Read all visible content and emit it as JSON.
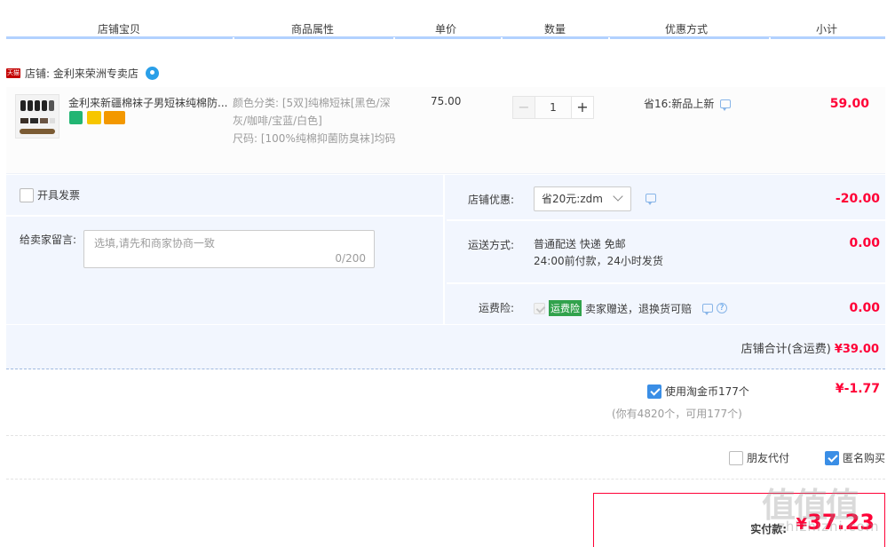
{
  "header": {
    "columns": [
      "店铺宝贝",
      "商品属性",
      "单价",
      "数量",
      "优惠方式",
      "小计"
    ]
  },
  "shop": {
    "badge": "天猫",
    "name": "店铺: 金利来荣洲专卖店"
  },
  "item": {
    "title": "金利来新疆棉袜子男短袜纯棉防...",
    "attr_color": "颜色分类: [5双]纯棉短袜[黑色/深灰/咖啡/宝蓝/白色]",
    "attr_size": "尺码: [100%纯棉抑菌防臭袜]均码",
    "price": "75.00",
    "quantity": "1",
    "promo": "省16:新品上新",
    "subtotal": "59.00",
    "badge_colors": [
      "#22b573",
      "#f7c600",
      "#f39800"
    ]
  },
  "options": {
    "invoice_label": "开具发票",
    "message_label": "给卖家留言:",
    "message_placeholder": "选填,请先和商家协商一致",
    "message_count": "0/200",
    "shop_discount_label": "店铺优惠:",
    "shop_discount_value": "省20元:zdm",
    "shop_discount_amount": "-20.00",
    "shipping_label": "运送方式:",
    "shipping_line1": "普通配送 快递 免邮",
    "shipping_line2": "24:00前付款，24小时发货",
    "shipping_amount": "0.00",
    "insurance_label": "运费险:",
    "insurance_badge": "运费险",
    "insurance_text": "卖家赠送，退换货可赔",
    "insurance_amount": "0.00"
  },
  "shop_total": {
    "label": "店铺合计(含运费)",
    "value": "¥39.00"
  },
  "coins": {
    "label": "使用淘金币177个",
    "sub": "(你有4820个，可用177个)",
    "value": "¥-1.77",
    "checked": true
  },
  "pay_options": {
    "friend_pay": "朋友代付",
    "anonymous": "匿名购买",
    "anonymous_checked": true
  },
  "payment": {
    "label": "实付款:",
    "currency": "¥",
    "amount": "37.23"
  },
  "watermark": {
    "text": "值值值",
    "sub": "zhizhizhi.com"
  },
  "colors": {
    "accent_red": "#ff0036",
    "panel_bg": "#f2f6fe",
    "header_line": "#b2d1ff",
    "checkbox_blue": "#3a8ee6"
  }
}
